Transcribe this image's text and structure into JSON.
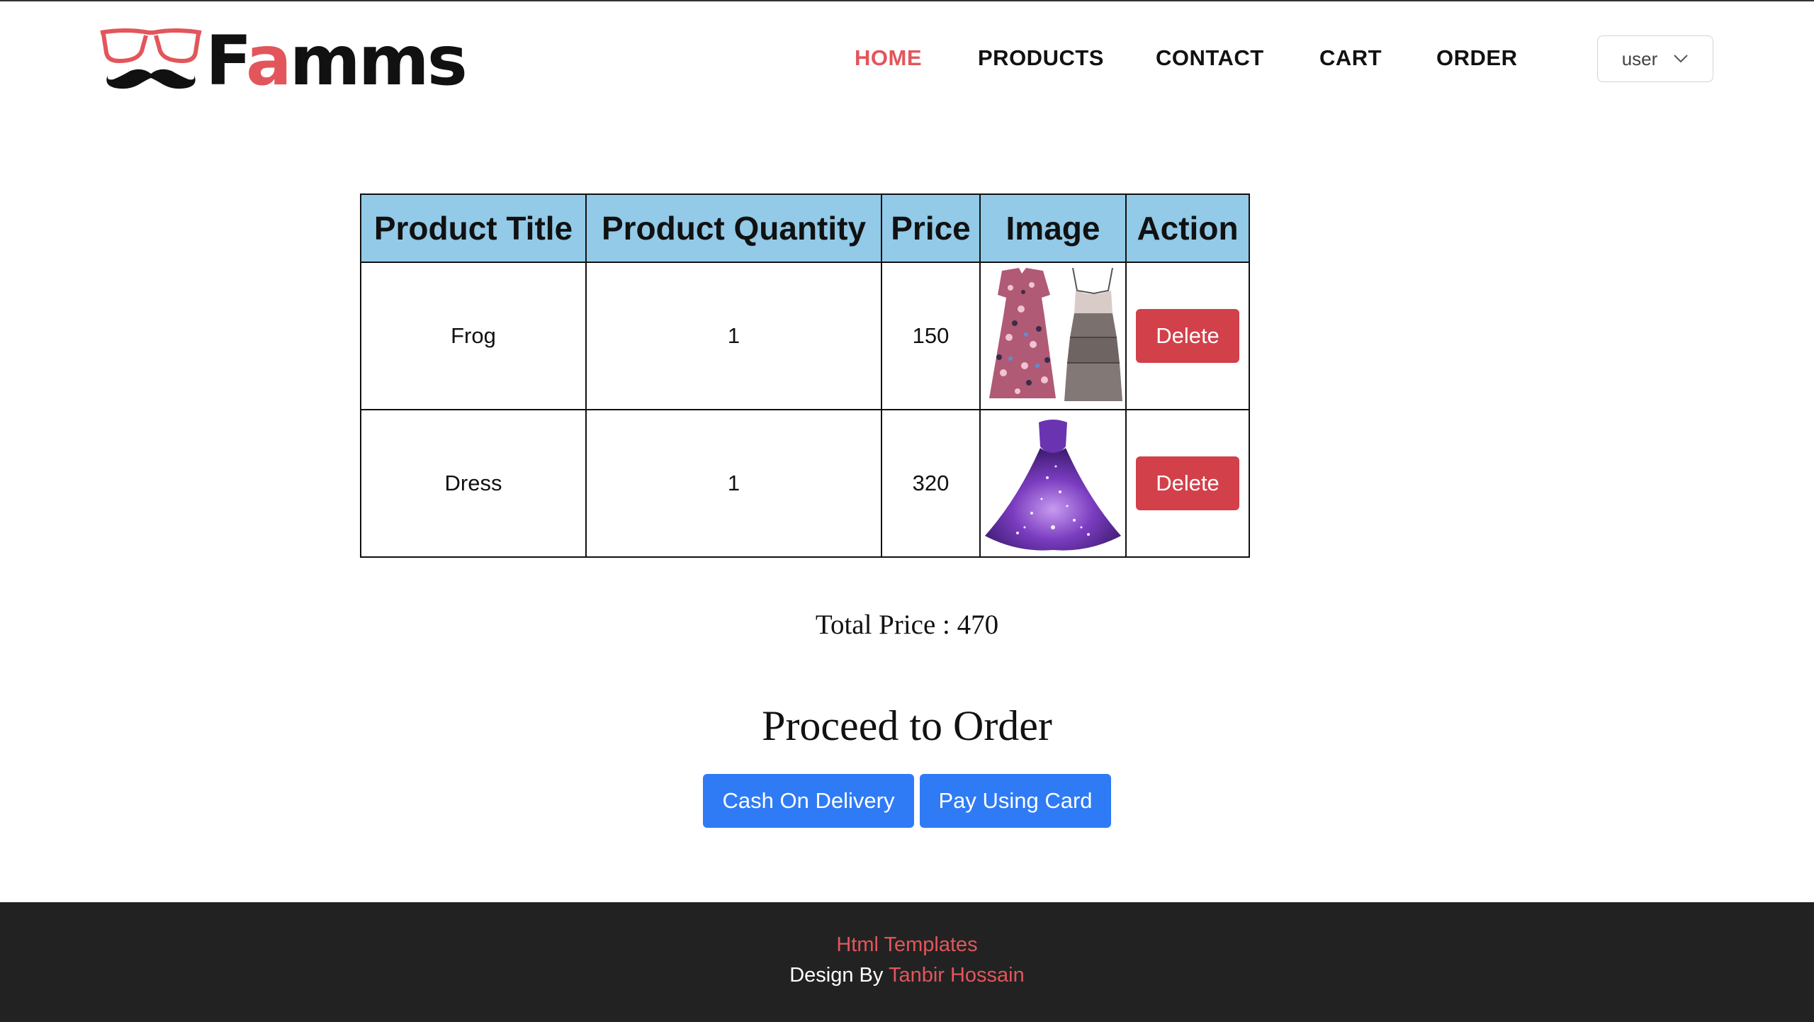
{
  "brand": {
    "name_prefix": "F",
    "name_accent": "a",
    "name_suffix": "mms",
    "accent_color": "#e2565b",
    "icon": "glasses-mustache-icon"
  },
  "nav": {
    "items": [
      {
        "label": "HOME",
        "active": true
      },
      {
        "label": "PRODUCTS",
        "active": false
      },
      {
        "label": "CONTACT",
        "active": false
      },
      {
        "label": "CART",
        "active": false
      },
      {
        "label": "ORDER",
        "active": false
      }
    ],
    "user_menu": {
      "label": "user",
      "icon": "chevron-down-icon"
    }
  },
  "cart": {
    "header_bg": "#92cae8",
    "columns": [
      "Product Title",
      "Product Quantity",
      "Price",
      "Image",
      "Action"
    ],
    "rows": [
      {
        "title": "Frog",
        "quantity": "1",
        "price": "150",
        "image": "floral-and-tiered-dress-photo",
        "action": "Delete"
      },
      {
        "title": "Dress",
        "quantity": "1",
        "price": "320",
        "image": "purple-galaxy-gown-photo",
        "action": "Delete"
      }
    ]
  },
  "total": {
    "text": "Total Price : 470"
  },
  "order": {
    "heading": "Proceed to Order",
    "cod_label": "Cash On Delivery",
    "card_label": "Pay Using Card",
    "button_color": "#2f7bf5"
  },
  "footer": {
    "templates_link": "Html Templates",
    "design_prefix": "Design By",
    "designer_link": "Tanbir Hossain",
    "bg_color": "#222222"
  }
}
